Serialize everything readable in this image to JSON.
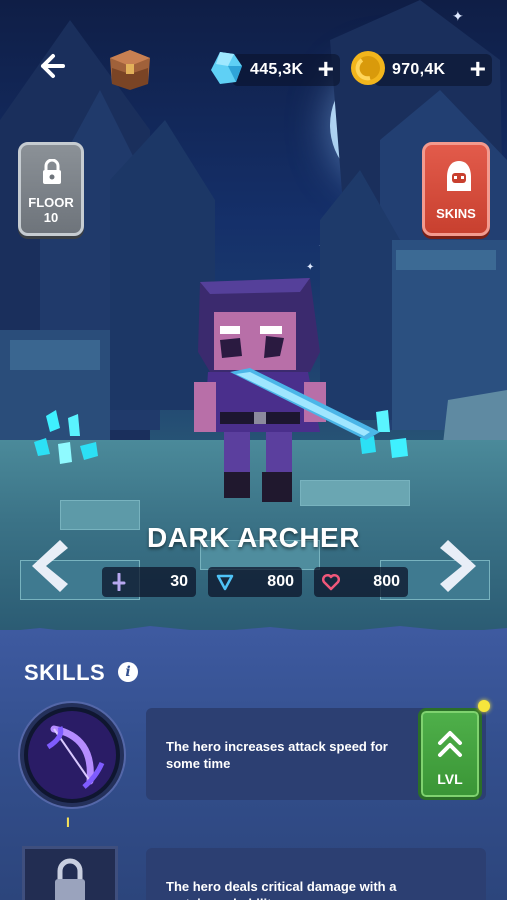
{
  "topbar": {
    "gems": "445,3K",
    "gold": "970,4K",
    "plus": "+"
  },
  "floor": {
    "label_line1": "FLOOR",
    "label_line2": "10"
  },
  "skins": {
    "label": "SKINS"
  },
  "hero": {
    "name": "DARK ARCHER",
    "stats": {
      "attack": "30",
      "defense": "800",
      "health": "800"
    }
  },
  "skills": {
    "title": "SKILLS",
    "info": "i",
    "items": [
      {
        "level": "I",
        "description": "The hero increases attack speed for some time",
        "button": "LVL"
      },
      {
        "description": "The hero deals critical damage with a certain probability"
      }
    ]
  },
  "colors": {
    "panel": "#34508f",
    "lvl_button": "#3a9536",
    "skins_button": "#c8402f",
    "floor_button": "#6e747b",
    "notify": "#f6e53c"
  }
}
